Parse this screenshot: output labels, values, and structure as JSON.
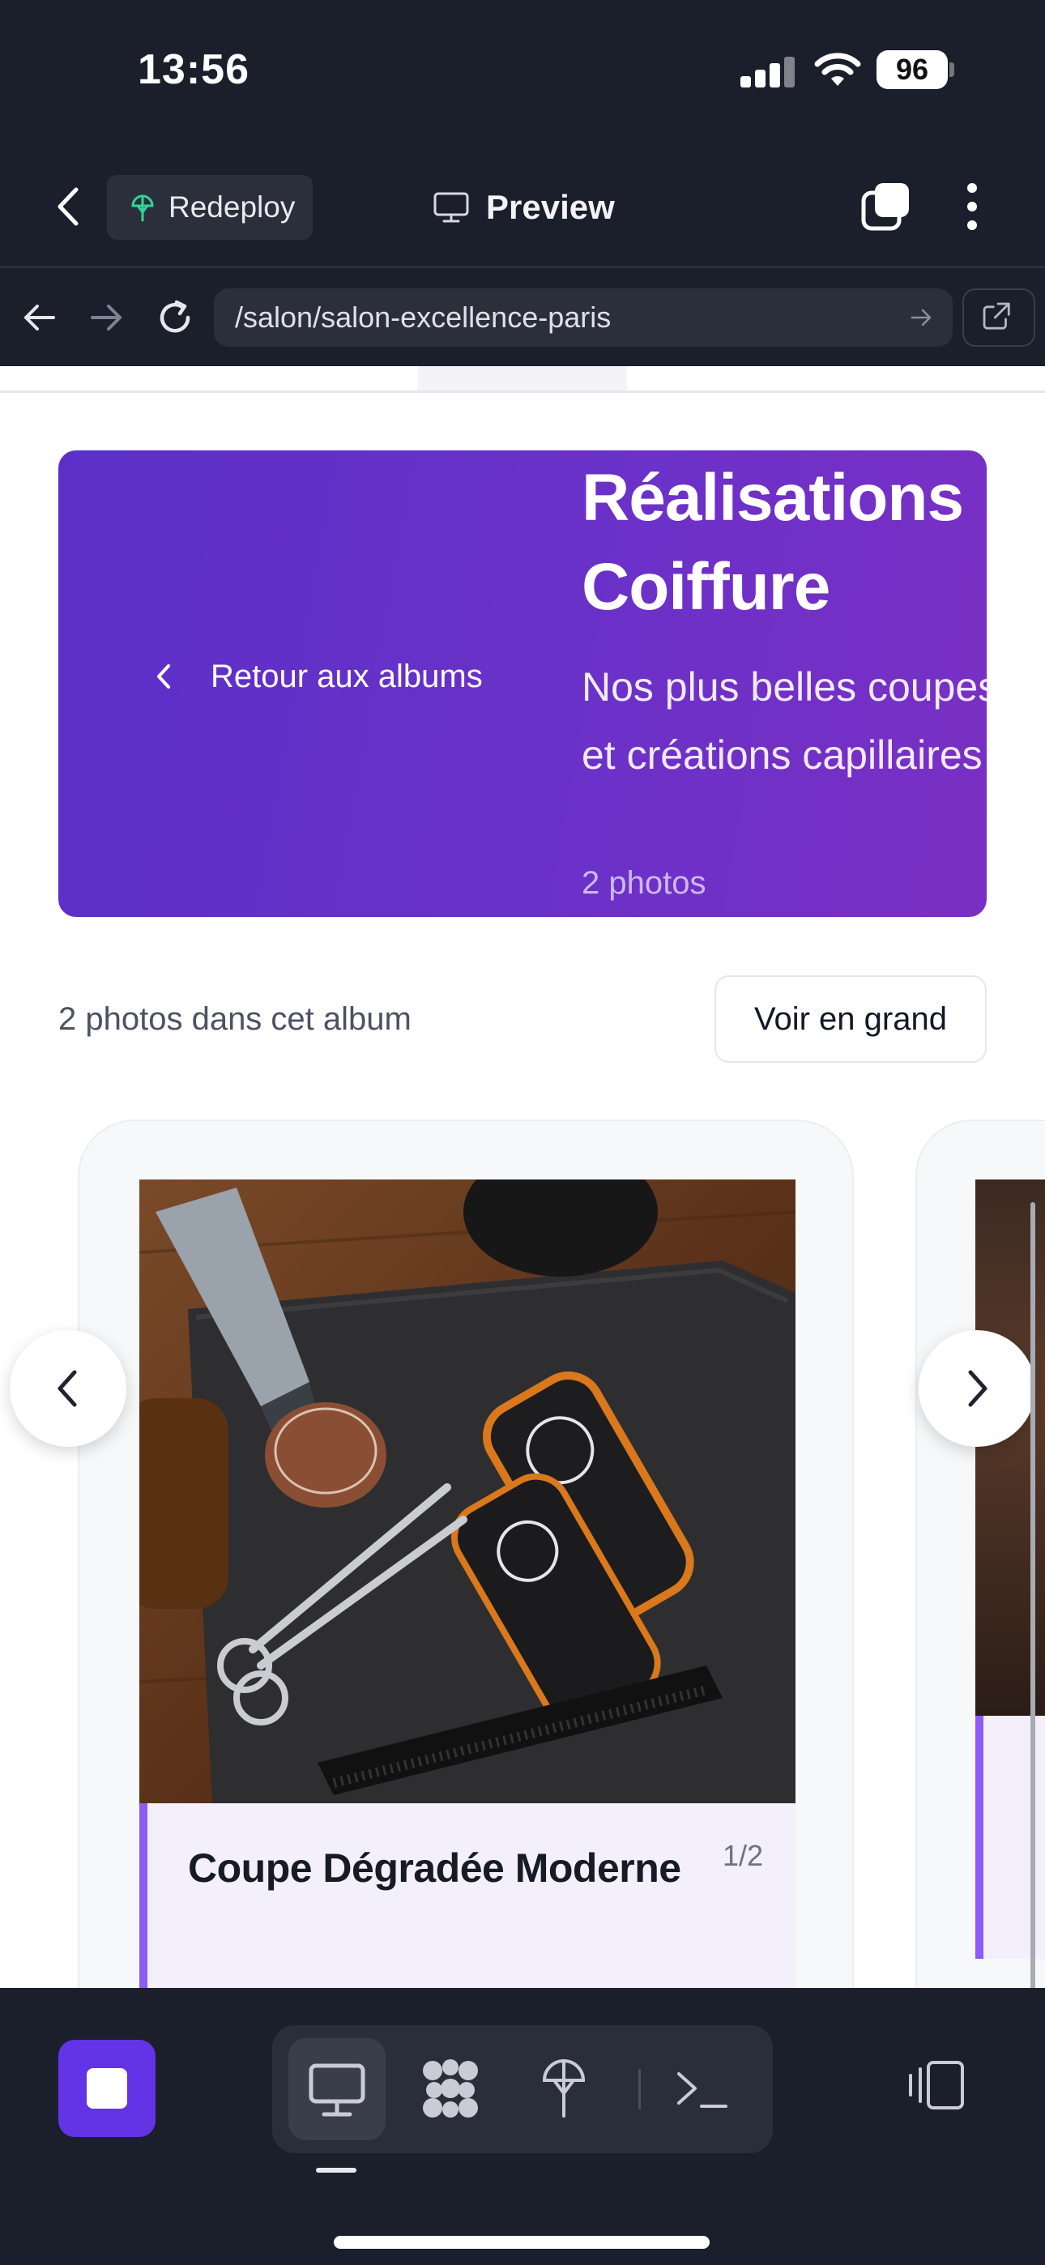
{
  "status_bar": {
    "time": "13:56",
    "battery": "96"
  },
  "app_bar": {
    "redeploy_label": "Redeploy",
    "preview_label": "Preview"
  },
  "browser": {
    "url": "/salon/salon-excellence-paris"
  },
  "hero": {
    "back_label": "Retour aux albums",
    "title": "Réalisations Coiffure",
    "subtitle": "Nos plus belles coupes et créations capillaires",
    "photo_count": "2 photos"
  },
  "album_bar": {
    "count_text": "2 photos dans cet album",
    "view_large_label": "Voir en grand"
  },
  "carousel": {
    "current": {
      "title": "Coupe Dégradée Moderne",
      "index": "1/2"
    },
    "accent": "#8b5cf6"
  },
  "colors": {
    "chrome_bg": "#1b1e2b",
    "hero_start": "#5b30c9",
    "hero_end": "#7a2fc4",
    "stop_button": "#6234e6"
  },
  "icons": [
    "back-arrow-icon",
    "redeploy-tree-icon",
    "monitor-icon",
    "tabs-icon",
    "more-vertical-icon",
    "reload-icon",
    "external-link-icon",
    "chevron-left-icon",
    "chevron-right-icon",
    "stop-icon",
    "desktop-icon",
    "apps-icon",
    "deploy-icon",
    "terminal-icon",
    "device-switch-icon"
  ]
}
